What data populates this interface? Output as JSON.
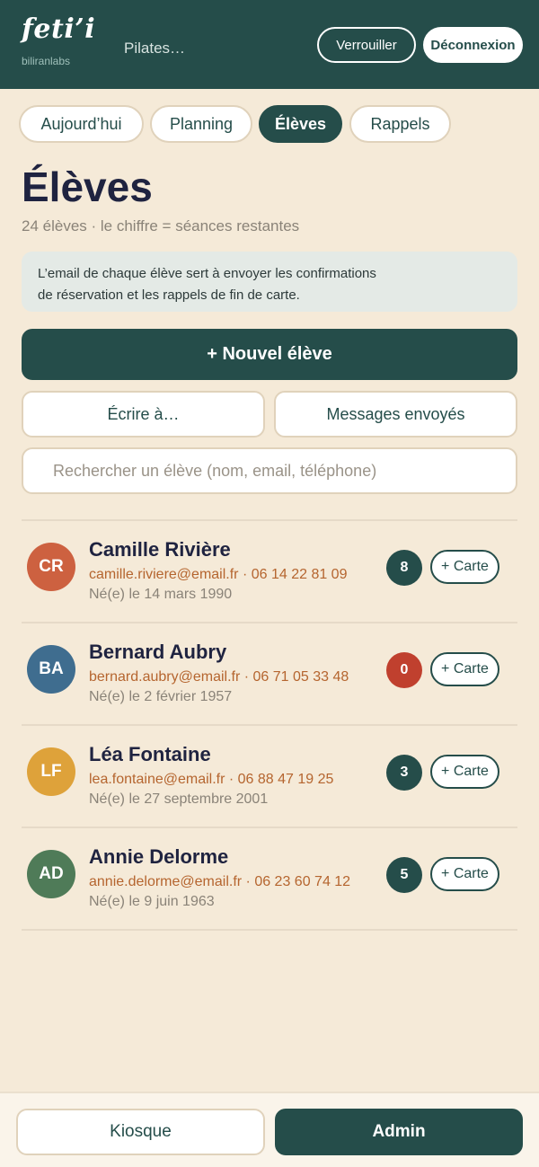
{
  "header": {
    "logo": "feti’i",
    "logo_sub": "biliranlabs",
    "app_title": "Pilates…",
    "lock_label": "Verrouiller",
    "logout_label": "Déconnexion"
  },
  "tabs": [
    {
      "label": "Aujourd’hui",
      "active": false
    },
    {
      "label": "Planning",
      "active": false
    },
    {
      "label": "Élèves",
      "active": true
    },
    {
      "label": "Rappels",
      "active": false
    }
  ],
  "page": {
    "title": "Élèves",
    "subtitle": "24 élèves · le chiffre = séances restantes",
    "info_line1": "L’email de chaque élève sert à envoyer les confirmations",
    "info_line2": "de réservation et les rappels de fin de carte."
  },
  "actions": {
    "new_student": "+ Nouvel élève",
    "write_to": "Écrire à…",
    "sent_messages": "Messages envoyés"
  },
  "search": {
    "placeholder": "Rechercher un élève (nom, email, téléphone)",
    "value": ""
  },
  "students": [
    {
      "initials": "CR",
      "color": "#cd6140",
      "name": "Camille Rivière",
      "contact": "camille.riviere@email.fr · 06 14 22 81 09",
      "birth": "Né(e) le 14 mars 1990",
      "sessions": "8",
      "card_label": "+ Carte"
    },
    {
      "initials": "BA",
      "color": "#3f6d8f",
      "name": "Bernard Aubry",
      "contact": "bernard.aubry@email.fr · 06 71 05 33 48",
      "birth": "Né(e) le 2 février 1957",
      "sessions": "0",
      "card_label": "+ Carte"
    },
    {
      "initials": "LF",
      "color": "#dea23a",
      "name": "Léa Fontaine",
      "contact": "lea.fontaine@email.fr · 06 88 47 19 25",
      "birth": "Né(e) le 27 septembre 2001",
      "sessions": "3",
      "card_label": "+ Carte"
    },
    {
      "initials": "AD",
      "color": "#4f7b58",
      "name": "Annie Delorme",
      "contact": "annie.delorme@email.fr · 06 23 60 74 12",
      "birth": "Né(e) le 9 juin 1963",
      "sessions": "5",
      "card_label": "+ Carte"
    }
  ],
  "footer": {
    "kiosk": "Kiosque",
    "admin": "Admin"
  },
  "colors": {
    "primary": "#254d4a",
    "background": "#f5ead8",
    "accent_text": "#b5652f",
    "alert": "#c0402e"
  }
}
